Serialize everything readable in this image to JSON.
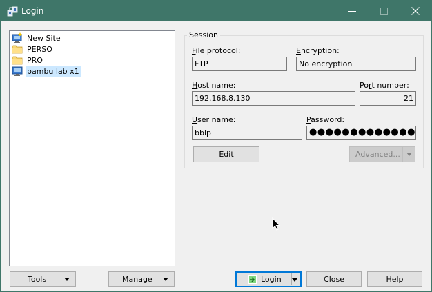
{
  "window": {
    "title": "Login",
    "icon": "winscp-icon",
    "accent": "#3f7669",
    "selection_color": "#cce8ff",
    "focus_color": "#0078d7"
  },
  "site_tree": {
    "items": [
      {
        "label": "New Site",
        "icon": "new-site-icon",
        "selected": false
      },
      {
        "label": "PERSO",
        "icon": "folder-icon",
        "selected": false
      },
      {
        "label": "PRO",
        "icon": "folder-icon",
        "selected": false
      },
      {
        "label": "bambu lab x1",
        "icon": "computer-icon",
        "selected": true
      }
    ]
  },
  "session": {
    "group_title": "Session",
    "file_protocol": {
      "label_key": "F",
      "label_rest": "ile protocol:",
      "value": "FTP"
    },
    "encryption": {
      "label_key": "E",
      "label_rest": "ncryption:",
      "value": "No encryption"
    },
    "host_name": {
      "label_key": "H",
      "label_rest": "ost name:",
      "value": "192.168.8.130"
    },
    "port_number": {
      "label_pre": "Po",
      "label_key": "r",
      "label_rest": "t number:",
      "value": "21"
    },
    "user_name": {
      "label_key": "U",
      "label_rest": "ser name:",
      "value": "bblp"
    },
    "password": {
      "label_key": "P",
      "label_rest": "assword:",
      "value": "●●●●●●●●●●●●●●●●"
    },
    "edit_label": "Edit",
    "advanced_label": "Advanced..."
  },
  "footer": {
    "tools_label": "Tools",
    "manage_label": "Manage",
    "login_label": "Login",
    "close_label": "Close",
    "help_label": "Help"
  }
}
